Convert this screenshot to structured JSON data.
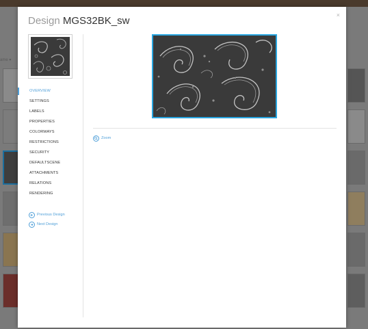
{
  "modal": {
    "title_prefix": "Design",
    "title_name": "MGS32BK_sw",
    "close_label": "×"
  },
  "sidebar": {
    "thumbnail_icon": "paisley-thumbnail",
    "nav": [
      {
        "label": "OVERVIEW",
        "active": true
      },
      {
        "label": "SETTINGS",
        "active": false
      },
      {
        "label": "LABELS",
        "active": false
      },
      {
        "label": "PROPERTIES",
        "active": false
      },
      {
        "label": "COLORWAYS",
        "active": false
      },
      {
        "label": "RESTRICTIONS",
        "active": false
      },
      {
        "label": "SECURITY",
        "active": false
      },
      {
        "label": "DEFAULTSCENE",
        "active": false
      },
      {
        "label": "ATTACHMENTS",
        "active": false
      },
      {
        "label": "RELATIONS",
        "active": false
      },
      {
        "label": "RENDERING",
        "active": false
      }
    ],
    "previous_design": "Previous Design",
    "next_design": "Next Design"
  },
  "main": {
    "zoom_label": "Zoom"
  },
  "background": {
    "label": "ame ▾"
  },
  "colors": {
    "accent": "#4f9fd8",
    "preview_border": "#29a6e0",
    "fabric_dark": "#3a3a3a",
    "fabric_light": "#bdbdbd"
  }
}
